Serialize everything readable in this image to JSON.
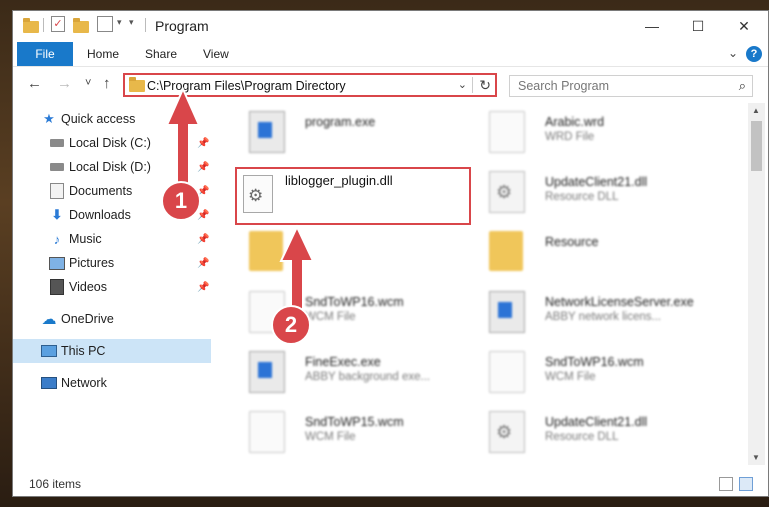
{
  "window": {
    "title": "Program",
    "controls": {
      "minimize": "—",
      "maximize": "☐",
      "close": "✕"
    }
  },
  "ribbon": {
    "file": "File",
    "tabs": [
      "Home",
      "Share",
      "View"
    ]
  },
  "navigation": {
    "back": "←",
    "forward": "→",
    "recent": "˅",
    "up": "↑",
    "address": "C:\\Program Files\\Program Directory",
    "search_placeholder": "Search Program"
  },
  "sidebar": {
    "items": [
      {
        "label": "Quick access",
        "icon": "star-icon"
      },
      {
        "label": "Local Disk (C:)",
        "icon": "drive-icon",
        "pinned": true
      },
      {
        "label": "Local Disk (D:)",
        "icon": "drive-icon",
        "pinned": true
      },
      {
        "label": "Documents",
        "icon": "documents-icon",
        "pinned": true
      },
      {
        "label": "Downloads",
        "icon": "download-icon",
        "pinned": true
      },
      {
        "label": "Music",
        "icon": "music-icon",
        "pinned": true
      },
      {
        "label": "Pictures",
        "icon": "pictures-icon",
        "pinned": true
      },
      {
        "label": "Videos",
        "icon": "videos-icon",
        "pinned": true
      },
      {
        "label": "OneDrive",
        "icon": "cloud-icon"
      },
      {
        "label": "This PC",
        "icon": "computer-icon",
        "selected": true
      },
      {
        "label": "Network",
        "icon": "network-icon"
      }
    ]
  },
  "files": [
    {
      "name": "program.exe",
      "type": "",
      "kind": "exe"
    },
    {
      "name": "Arabic.wrd",
      "type": "WRD File",
      "kind": "doc"
    },
    {
      "name": "liblogger_plugin.dll",
      "type": "",
      "kind": "gear",
      "highlighted": true
    },
    {
      "name": "UpdateClient21.dll",
      "type": "Resource DLL",
      "kind": "gear"
    },
    {
      "name": "",
      "type": "",
      "kind": "fold"
    },
    {
      "name": "Resource",
      "type": "",
      "kind": "fold"
    },
    {
      "name": "SndToWP16.wcm",
      "type": "WCM File",
      "kind": "doc"
    },
    {
      "name": "NetworkLicenseServer.exe",
      "type": "ABBY network licens...",
      "kind": "exe"
    },
    {
      "name": "FineExec.exe",
      "type": "ABBY background exe...",
      "kind": "exe"
    },
    {
      "name": "SndToWP16.wcm",
      "type": "WCM File",
      "kind": "doc"
    },
    {
      "name": "SndToWP15.wcm",
      "type": "WCM File",
      "kind": "doc"
    },
    {
      "name": "UpdateClient21.dll",
      "type": "Resource DLL",
      "kind": "gear"
    }
  ],
  "status": {
    "count": "106 items"
  },
  "annotations": {
    "step1": "1",
    "step2": "2",
    "color": "#d9464a"
  }
}
